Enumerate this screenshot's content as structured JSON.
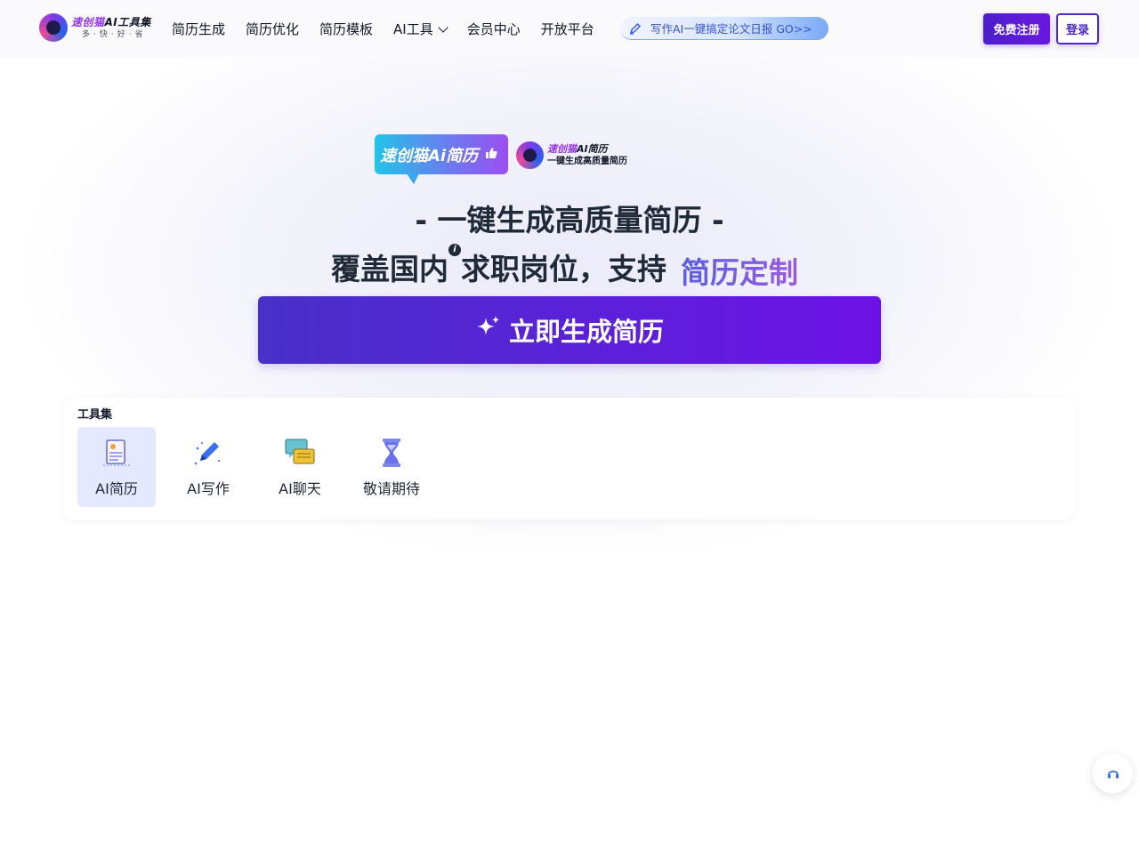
{
  "header": {
    "logo": {
      "title_a": "速创猫",
      "title_b": "AI工具集",
      "subtitle": "多·快·好·省"
    },
    "nav": [
      {
        "label": "简历生成"
      },
      {
        "label": "简历优化"
      },
      {
        "label": "简历模板"
      },
      {
        "label": "AI工具",
        "has_dropdown": true
      },
      {
        "label": "会员中心"
      },
      {
        "label": "开放平台"
      }
    ],
    "promo": {
      "icon": "pencil-icon",
      "text": "写作AI一键搞定论文日报 GO>>"
    },
    "register_label": "免费注册",
    "login_label": "登录"
  },
  "hero": {
    "badge": {
      "text": "速创猫Ai简历",
      "icon": "thumbs-up-icon"
    },
    "brand": {
      "title_a": "速创猫",
      "title_b": "AI简历",
      "subtitle": "一键生成高质量简历"
    },
    "headline": "- 一键生成高质量简历 -",
    "subline_a": "覆盖国内",
    "subline_b": "求职岗位，支持",
    "highlight": "简历定制",
    "cta_label": "立即生成简历",
    "cta_icon": "sparkles-icon"
  },
  "tools": {
    "title": "工具集",
    "items": [
      {
        "label": "AI简历",
        "icon": "resume-icon",
        "active": true
      },
      {
        "label": "AI写作",
        "icon": "pen-icon",
        "active": false
      },
      {
        "label": "AI聊天",
        "icon": "chat-icon",
        "active": false
      },
      {
        "label": "敬请期待",
        "icon": "hourglass-icon",
        "active": false
      }
    ]
  },
  "colors": {
    "primary": "#4c28c8",
    "cta_gradient": [
      "#4830c8",
      "#6d12e6"
    ],
    "active_tool_bg": "#e4e9ff",
    "highlight_text": "#5b5fe0"
  }
}
